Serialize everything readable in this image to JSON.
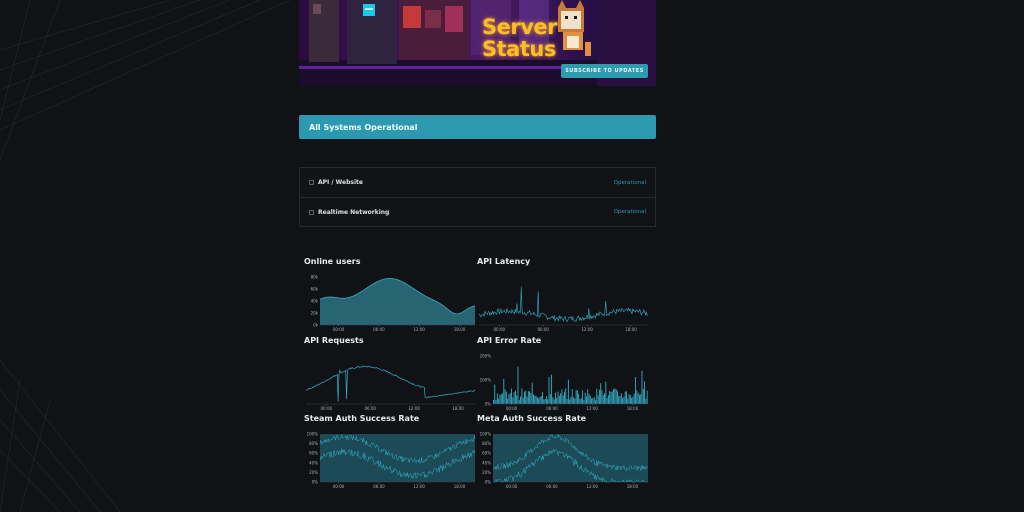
{
  "banner": {
    "title_line1": "Server",
    "title_line2": "Status",
    "subscribe_label": "SUBSCRIBE TO UPDATES"
  },
  "status": {
    "overall": "All Systems Operational"
  },
  "components": [
    {
      "name": "API / Website",
      "status": "Operational"
    },
    {
      "name": "Realtime Networking",
      "status": "Operational"
    }
  ],
  "colors": {
    "accent": "#2b9ab1",
    "background": "#101215",
    "area_fill": "#2a6f7d",
    "line": "#33aec6"
  },
  "chart_data": [
    {
      "title": "Online users",
      "type": "area",
      "x_ticks": [
        "00:00",
        "06:00",
        "12:00",
        "18:00"
      ],
      "y_ticks": [
        "0k",
        "20k",
        "40k",
        "60k",
        "80k"
      ],
      "ylim": [
        0,
        80000
      ]
    },
    {
      "title": "API Latency",
      "type": "line",
      "x_ticks": [
        "00:00",
        "06:00",
        "12:00",
        "18:00"
      ],
      "y_ticks": []
    },
    {
      "title": "API Requests",
      "type": "line",
      "x_ticks": [
        "00:00",
        "06:00",
        "12:00",
        "18:00"
      ],
      "y_ticks": []
    },
    {
      "title": "API Error Rate",
      "type": "bar",
      "x_ticks": [
        "00:00",
        "06:00",
        "12:00",
        "18:00"
      ],
      "y_ticks": [
        "200%",
        "100%",
        "0%"
      ]
    },
    {
      "title": "Steam Auth Success Rate",
      "type": "area",
      "x_ticks": [
        "00:00",
        "06:00",
        "12:00",
        "18:00"
      ],
      "y_ticks": [
        "0%",
        "20%",
        "40%",
        "60%",
        "80%",
        "100%"
      ],
      "ylim": [
        0,
        100
      ]
    },
    {
      "title": "Meta Auth Success Rate",
      "type": "area",
      "x_ticks": [
        "00:00",
        "06:00",
        "12:00",
        "18:00"
      ],
      "y_ticks": [
        "0%",
        "20%",
        "40%",
        "60%",
        "80%",
        "100%"
      ],
      "ylim": [
        0,
        100
      ]
    }
  ]
}
